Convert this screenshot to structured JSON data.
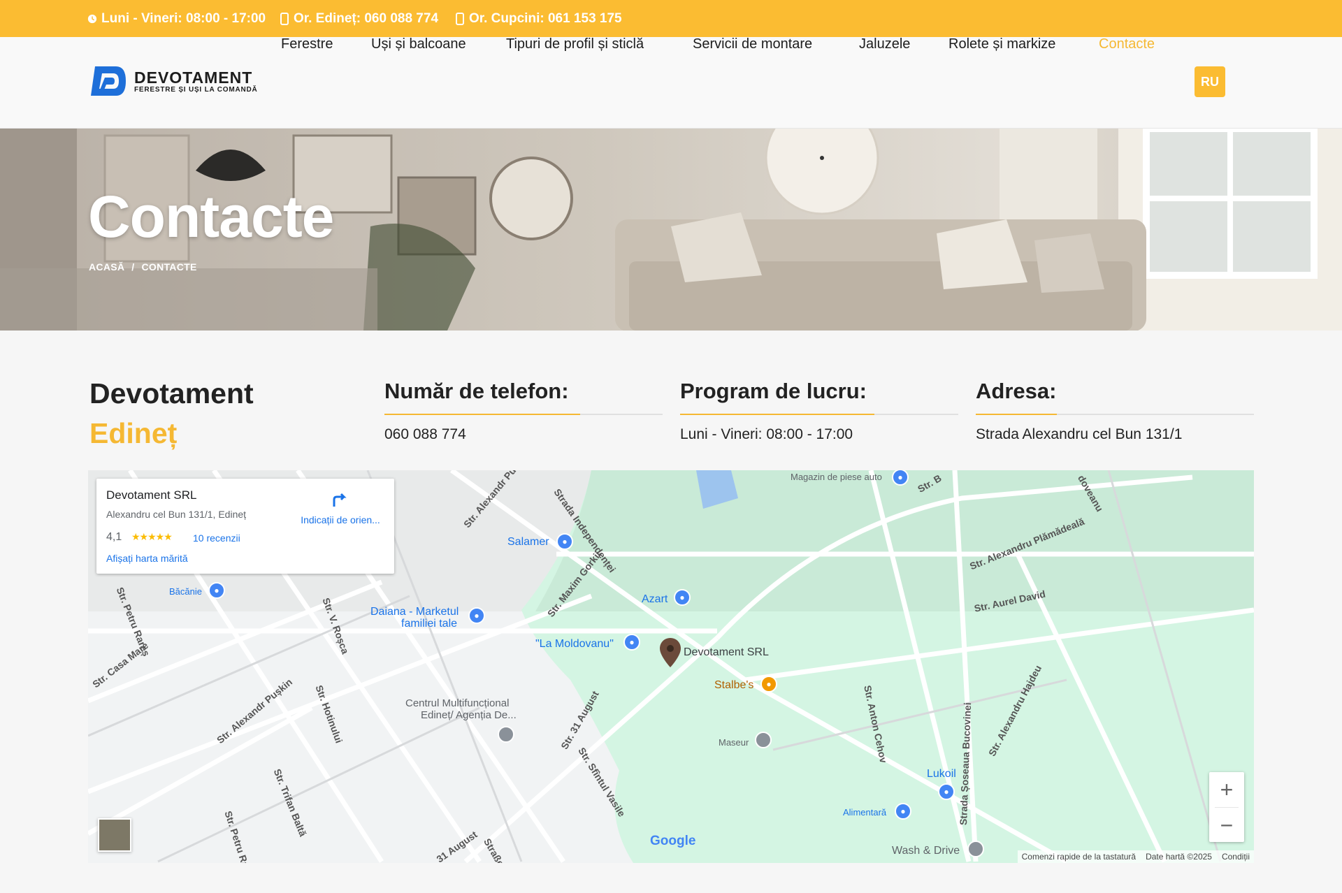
{
  "topbar": {
    "hours": "Luni - Vineri: 08:00 - 17:00",
    "phone_edinet": "Or. Edineț: 060 088 774",
    "phone_cupcini": "Or. Cupcini: 061 153 175"
  },
  "logo": {
    "name": "DEVOTAMENT",
    "tagline": "FERESTRE ȘI UȘI LA COMANDĂ"
  },
  "nav": {
    "items": [
      "Ferestre",
      "Uși și balcoane",
      "Tipuri de profil și sticlă",
      "Servicii de montare",
      "Jaluzele",
      "Rolete și markize",
      "Contacte"
    ],
    "active": "Contacte",
    "lang": "RU"
  },
  "hero": {
    "title": "Contacte",
    "breadcrumb_home": "ACASĂ",
    "breadcrumb_sep": "/",
    "breadcrumb_current": "CONTACTE"
  },
  "contact": {
    "company": "Devotament",
    "city": "Edineț",
    "phone_heading": "Număr de telefon:",
    "phone": "060 088 774",
    "hours_heading": "Program de lucru:",
    "hours": "Luni - Vineri: 08:00 - 17:00",
    "address_heading": "Adresa:",
    "address": "Strada Alexandru cel Bun 131/1"
  },
  "map": {
    "card": {
      "name": "Devotament SRL",
      "address": "Alexandru cel Bun 131/1, Edineț",
      "rating": "4,1",
      "stars": "★★★★★",
      "reviews": "10 recenzii",
      "larger_map": "Afișați harta mărită",
      "directions": "Indicații de orien..."
    },
    "pois": {
      "magazin": "Magazin de piese auto",
      "salamer": "Salamer",
      "bacanie": "Băcănie",
      "azart": "Azart",
      "daiana": "Daiana - Marketul",
      "daiana2": "familiei tale",
      "moldovanu": "\"La Moldovanu\"",
      "devotament": "Devotament SRL",
      "stalbes": "Stalbe's",
      "centrul": "Centrul Multifuncțional",
      "centrul2": "Edineț/ Agenția De...",
      "maseur": "Maseur",
      "lukoil": "Lukoil",
      "alimentara": "Alimentară",
      "wash": "Wash & Drive"
    },
    "streets": {
      "pusk": "Str. Alexandr Pușk",
      "independentei": "Strada Independenței",
      "gorkii": "Str. Maxim Gorkii",
      "plamadeala": "Str. Alexandru Plămădeală",
      "david": "Str. Aurel David",
      "rosca": "Str. V. Roșca",
      "rares": "Str. Petru Rareș",
      "casamare": "Str. Casa Mare",
      "puskin": "Str. Alexandr Pușkin",
      "hotinului": "Str. Hotinului",
      "trifan": "Str. Trifan Baltă",
      "rares2": "Str. Petru Rareș",
      "august": "Str. 31 August",
      "vasile": "Str. Sfîntul Vasile",
      "cehov": "Str. Anton Cehov",
      "bucovinei": "Strada Șoseaua Bucovinei",
      "hajdeu": "Str. Alexandru Hajdeu",
      "august2": "31 August",
      "strasse": "Straße",
      "bu": "Str. B",
      "doveanu": "doveanu"
    },
    "google": "Google",
    "attrib_keys": "Comenzi rapide de la tastatură",
    "attrib_data": "Date hartă ©2025",
    "attrib_terms": "Condiții",
    "zoom_in": "+",
    "zoom_out": "−"
  },
  "colors": {
    "accent": "#fbbc32",
    "accent_text": "#f5b833",
    "logo_blue": "#1e6fd9"
  }
}
